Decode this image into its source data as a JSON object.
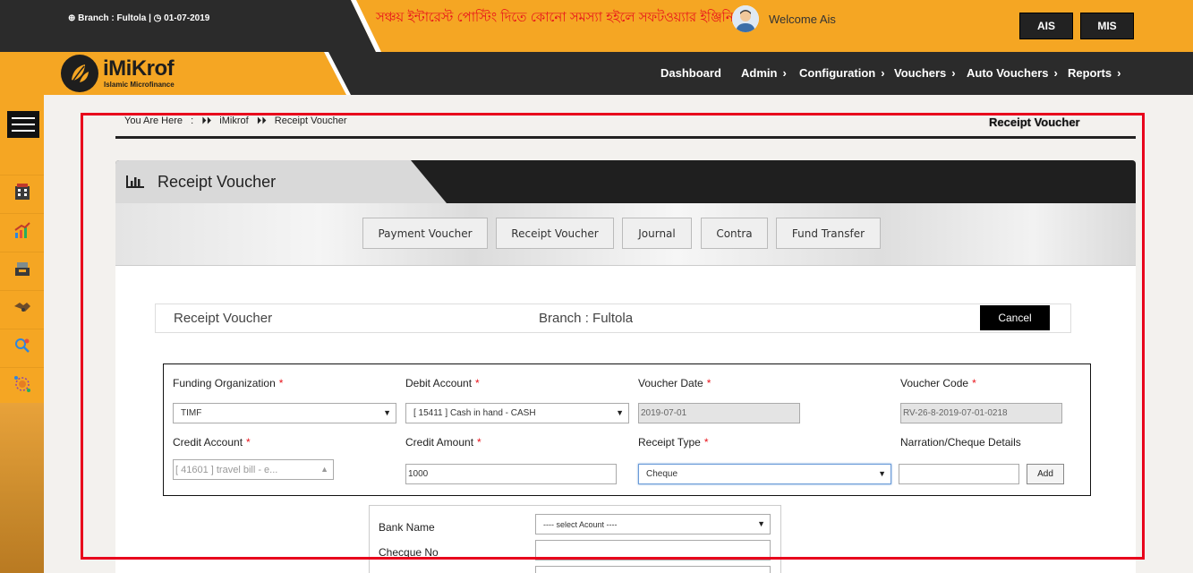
{
  "header": {
    "branch_text": "Branch : Fultola |",
    "date_text": "01-07-2019",
    "notice": "সঞ্চয় ইন্টারেস্ট পোস্টিং দিতে কোনো সমস্যা হইলে সফটওয়্যার ইঞ্জিনি",
    "welcome": "Welcome Ais",
    "btn_ais": "AIS",
    "btn_mis": "MIS"
  },
  "logo": {
    "title": "iMiKrof",
    "subtitle": "Islamic Microfinance"
  },
  "nav": {
    "items": [
      "Dashboard",
      "Admin",
      "Configuration",
      "Vouchers",
      "Auto Vouchers",
      "Reports"
    ]
  },
  "breadcrumb": {
    "prefix": "You Are Here",
    "sep": ":",
    "root": "iMikrof",
    "current": "Receipt Voucher"
  },
  "page_title": "Receipt Voucher",
  "panel": {
    "title": "Receipt Voucher"
  },
  "tabs": [
    "Payment Voucher",
    "Receipt Voucher",
    "Journal",
    "Contra",
    "Fund Transfer"
  ],
  "voucher_bar": {
    "title": "Receipt Voucher",
    "branch": "Branch : Fultola",
    "cancel": "Cancel"
  },
  "form": {
    "funding_org_label": "Funding Organization",
    "funding_org_value": "TIMF",
    "debit_account_label": "Debit Account",
    "debit_account_value": "[ 15411 ] Cash in hand - CASH",
    "voucher_date_label": "Voucher Date",
    "voucher_date_value": "2019-07-01",
    "voucher_code_label": "Voucher Code",
    "voucher_code_value": "RV-26-8-2019-07-01-0218",
    "credit_account_label": "Credit Account",
    "credit_account_value": "[ 41601 ] travel bill - e...",
    "credit_amount_label": "Credit Amount",
    "credit_amount_value": "1000",
    "receipt_type_label": "Receipt Type",
    "receipt_type_value": "Cheque",
    "narration_label": "Narration/Cheque Details",
    "narration_value": "",
    "add_label": "Add",
    "required_mark": "*"
  },
  "bank": {
    "bank_name_label": "Bank Name",
    "bank_name_value": "---- select Acount ----",
    "cheque_no_label": "Checque No"
  },
  "colors": {
    "brand_orange": "#f5a623",
    "dark": "#2b2b2b",
    "notice_red": "#e8131b",
    "frame_red": "#e8001c"
  }
}
